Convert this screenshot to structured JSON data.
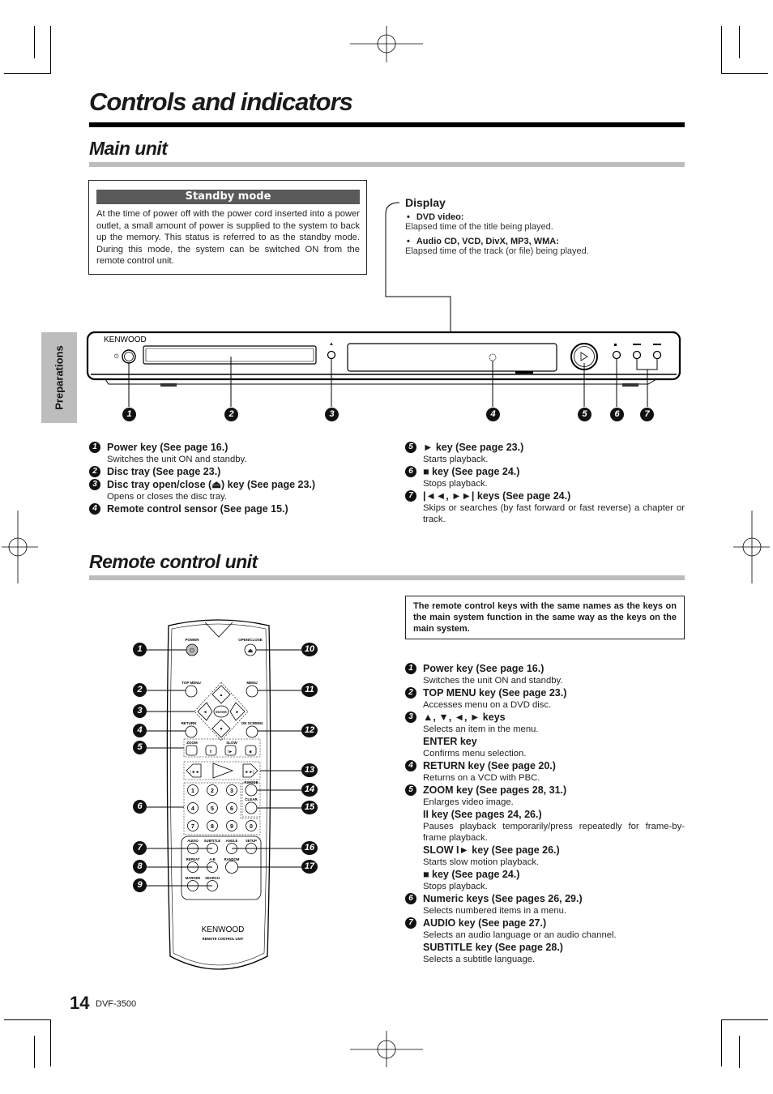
{
  "page": {
    "title": "Controls and indicators",
    "side_tab": "Preparations",
    "page_number": "14",
    "model": "DVF-3500"
  },
  "main_unit": {
    "heading": "Main unit",
    "standby": {
      "title": "Standby mode",
      "body": "At the time of power off with the power cord inserted into a power outlet, a small amount of power is supplied to the system to back up the memory. This status is referred to as the standby mode. During this mode, the system can be switched ON from the remote control unit."
    },
    "display": {
      "title": "Display",
      "items": [
        {
          "label": "DVD video:",
          "desc": "Elapsed time of the title being played."
        },
        {
          "label": "Audio CD, VCD, DivX, MP3, WMA:",
          "desc": "Elapsed time of the track (or file) being played."
        }
      ]
    },
    "device": {
      "brand": "KENWOOD",
      "callouts": [
        "1",
        "2",
        "3",
        "4",
        "5",
        "6",
        "7"
      ]
    },
    "items_left": [
      {
        "num": "1",
        "title": "Power key (See page 16.)",
        "desc": "Switches the unit ON and standby."
      },
      {
        "num": "2",
        "title": "Disc tray (See page 23.)",
        "desc": ""
      },
      {
        "num": "3",
        "title": "Disc tray open/close (⏏) key (See page 23.)",
        "desc": "Opens or closes the disc tray."
      },
      {
        "num": "4",
        "title": "Remote control sensor (See page 15.)",
        "desc": ""
      }
    ],
    "items_right": [
      {
        "num": "5",
        "title": "► key (See page 23.)",
        "desc": "Starts playback."
      },
      {
        "num": "6",
        "title": "■ key (See page 24.)",
        "desc": "Stops playback."
      },
      {
        "num": "7",
        "title": "|◄◄, ►►| keys (See page 24.)",
        "desc": "Skips or searches (by fast forward or fast reverse) a chapter or track."
      }
    ]
  },
  "remote": {
    "heading": "Remote control unit",
    "note": "The remote control keys with the same names as the keys on the main system function in the same way as the keys on the main system.",
    "labels": {
      "power": "POWER",
      "open_close": "OPEN/CLOSE",
      "top_menu": "TOP MENU",
      "menu": "MENU",
      "enter": "ENTER",
      "return": "RETURN",
      "on_screen": "ON SCREEN",
      "zoom": "ZOOM",
      "slow": "SLOW",
      "pmode": "P.MODE",
      "clear": "CLEAR",
      "audio": "AUDIO",
      "subtitle": "SUBTITLE",
      "angle": "ANGLE",
      "setup": "SETUP",
      "repeat": "REPEAT",
      "ab": "A-B",
      "random": "RANDOM",
      "marker": "MARKER",
      "search": "SEARCH",
      "brand": "KENWOOD",
      "unit": "REMOTE CONTROL UNIT",
      "digits": [
        "1",
        "2",
        "3",
        "4",
        "5",
        "6",
        "7",
        "8",
        "9",
        "0"
      ]
    },
    "callouts_left": [
      "1",
      "2",
      "3",
      "4",
      "5",
      "6",
      "7",
      "8",
      "9"
    ],
    "callouts_right": [
      "10",
      "11",
      "12",
      "13",
      "14",
      "15",
      "16",
      "17"
    ],
    "items": [
      {
        "num": "1",
        "entries": [
          {
            "title": "Power key (See page 16.)",
            "desc": "Switches the unit ON and standby."
          }
        ]
      },
      {
        "num": "2",
        "entries": [
          {
            "title": "TOP MENU key (See page 23.)",
            "desc": "Accesses menu on a DVD disc."
          }
        ]
      },
      {
        "num": "3",
        "entries": [
          {
            "title": "▲, ▼, ◄, ► keys",
            "desc": "Selects an item in the menu."
          },
          {
            "title": "ENTER key",
            "desc": "Confirms menu selection."
          }
        ]
      },
      {
        "num": "4",
        "entries": [
          {
            "title": "RETURN key (See page 20.)",
            "desc": "Returns on a VCD with PBC."
          }
        ]
      },
      {
        "num": "5",
        "entries": [
          {
            "title": "ZOOM key (See pages 28, 31.)",
            "desc": "Enlarges video image."
          },
          {
            "title": "II key (See pages 24, 26.)",
            "desc": "Pauses playback temporarily/press repeatedly for frame-by-frame playback."
          },
          {
            "title": "SLOW I► key  (See page 26.)",
            "desc": "Starts slow motion playback."
          },
          {
            "title": "■ key (See page 24.)",
            "desc": "Stops playback."
          }
        ]
      },
      {
        "num": "6",
        "entries": [
          {
            "title": "Numeric keys (See pages 26, 29.)",
            "desc": "Selects numbered items in a menu."
          }
        ]
      },
      {
        "num": "7",
        "entries": [
          {
            "title": "AUDIO key (See page 27.)",
            "desc": "Selects an audio language or an audio channel."
          },
          {
            "title": "SUBTITLE key (See page 28.)",
            "desc": "Selects a subtitle language."
          }
        ]
      }
    ]
  }
}
